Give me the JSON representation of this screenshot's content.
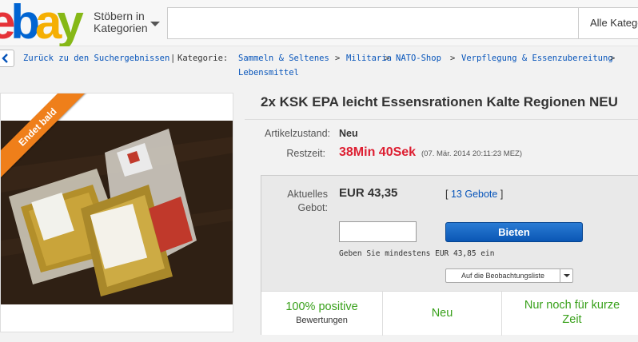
{
  "header": {
    "logo_text": "ebay",
    "browse_label_line1": "Stöbern in",
    "browse_label_line2": "Kategorien",
    "search_placeholder": "",
    "category_select": "Alle Katego"
  },
  "breadcrumb": {
    "back_label": "Zurück zu den Suchergebnissen",
    "separator": "|",
    "category_label": "Kategorie:",
    "items": [
      "Sammeln & Seltenes",
      "Militaria",
      "NATO-Shop",
      "Verpflegung & Essenzubereitung",
      "Lebensmittel"
    ],
    "arrow": ">"
  },
  "image_panel": {
    "ribbon_text": "Endet bald",
    "photo_icon": "product-photo"
  },
  "item": {
    "title": "2x KSK EPA leicht Essensrationen Kalte Regionen NEU",
    "condition_label": "Artikelzustand:",
    "condition_value": "Neu",
    "time_label": "Restzeit:",
    "time_left": "38Min 40Sek",
    "end_date": "(07. Mär. 2014  20:11:23 MEZ)"
  },
  "bidding": {
    "current_bid_label_line1": "Aktuelles",
    "current_bid_label_line2": "Gebot:",
    "price": "EUR 43,35",
    "bids_open": "[",
    "bids_link": "13 Gebote",
    "bids_close": "]",
    "bid_input_value": "",
    "bid_button": "Bieten",
    "min_bid_hint": "Geben Sie mindestens EUR 43,85 ein",
    "watchlist_label": "Auf die Beobachtungsliste"
  },
  "info_strip": {
    "feedback_value": "100% positive",
    "feedback_label": "Bewertungen",
    "condition": "Neu",
    "urgency_line1": "Nur noch für kurze",
    "urgency_line2": "Zeit"
  },
  "colors": {
    "ebay_red": "#e53238",
    "ebay_blue": "#0064d2",
    "ebay_yellow": "#f5af02",
    "ebay_green": "#86b817",
    "link_blue": "#0654ba",
    "time_red": "#dd1e31",
    "ribbon_orange": "#ef7f1a",
    "positive_green": "#38a01a"
  }
}
